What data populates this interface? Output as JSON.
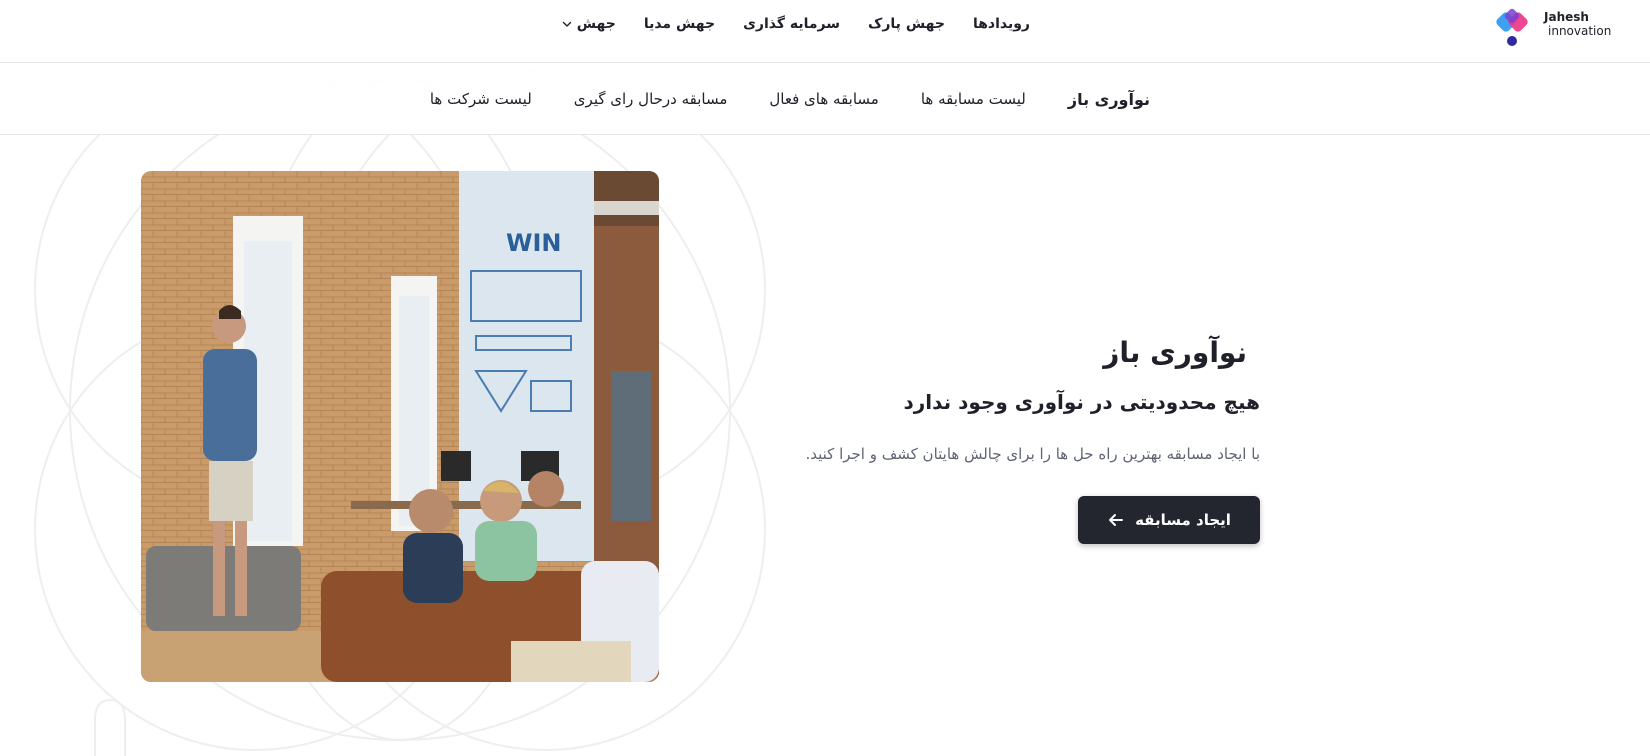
{
  "brand": {
    "name_line1": "Jahesh",
    "name_line2": "innovation",
    "colors": {
      "blue": "#3ea0f0",
      "pink": "#ec3c8c",
      "navy": "#2f2aa0"
    }
  },
  "main_menu": [
    {
      "label": "رویدادها"
    },
    {
      "label": "جهش پارک"
    },
    {
      "label": "سرمایه گذاری"
    },
    {
      "label": "جهش مدیا"
    },
    {
      "label": "جهش",
      "has_dropdown": true,
      "icon": "chevron-down-icon"
    }
  ],
  "sub_nav": [
    {
      "label": "نوآوری باز",
      "active": true
    },
    {
      "label": "لیست مسابقه ها"
    },
    {
      "label": "مسابقه های فعال"
    },
    {
      "label": "مسابقه درحال رای گیری"
    },
    {
      "label": "لیست شرکت ها"
    }
  ],
  "hero": {
    "title": "نوآوری باز",
    "subtitle": "هیچ محدودیتی در نوآوری وجود ندارد",
    "description": "با ایجاد مسابقه بهترین راه حل ها را برای چالش هایتان کشف و اجرا کنید.",
    "cta_label": "ایجاد مسابقه",
    "cta_icon": "arrow-left-icon",
    "image_icon": "office-presentation-photo"
  },
  "colors": {
    "text_primary": "#1f2029",
    "text_secondary": "#5f6472",
    "button_bg": "#23262f",
    "button_text": "#ffffff",
    "divider": "#e6e6e6"
  }
}
